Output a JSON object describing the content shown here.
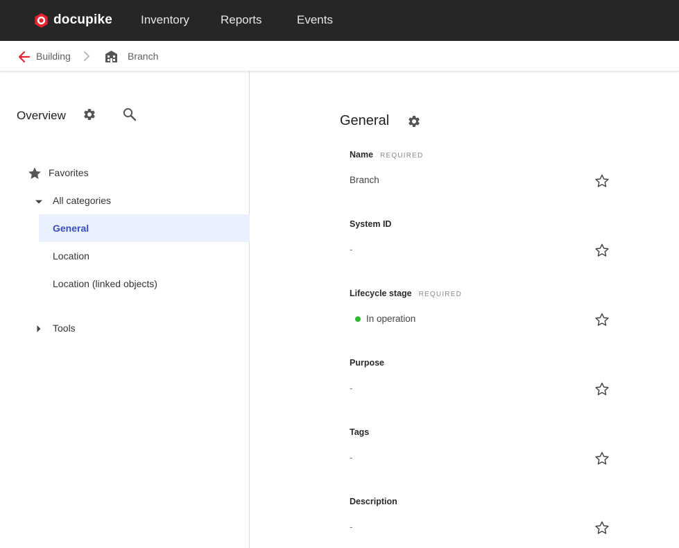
{
  "header": {
    "brand": "docupike",
    "nav": [
      "Inventory",
      "Reports",
      "Events"
    ]
  },
  "breadcrumb": {
    "back_label": "Building",
    "current_label": "Branch"
  },
  "sidebar": {
    "title": "Overview",
    "favorites_label": "Favorites",
    "all_categories_label": "All categories",
    "categories": [
      "General",
      "Location",
      "Location (linked objects)"
    ],
    "selected_category": "General",
    "tools_label": "Tools"
  },
  "main": {
    "title": "General",
    "fields": [
      {
        "label": "Name",
        "required": "REQUIRED",
        "value": "Branch"
      },
      {
        "label": "System ID",
        "required": "",
        "value": "-"
      },
      {
        "label": "Lifecycle stage",
        "required": "REQUIRED",
        "value": "In operation"
      },
      {
        "label": "Purpose",
        "required": "",
        "value": "-"
      },
      {
        "label": "Tags",
        "required": "",
        "value": "-"
      },
      {
        "label": "Description",
        "required": "",
        "value": "-"
      }
    ]
  },
  "colors": {
    "brand_red": "#e8222e",
    "topbar": "#262626",
    "selected_bg": "#e8f0fd",
    "selected_text": "#3b4cc0",
    "status_green": "#2db82d"
  }
}
